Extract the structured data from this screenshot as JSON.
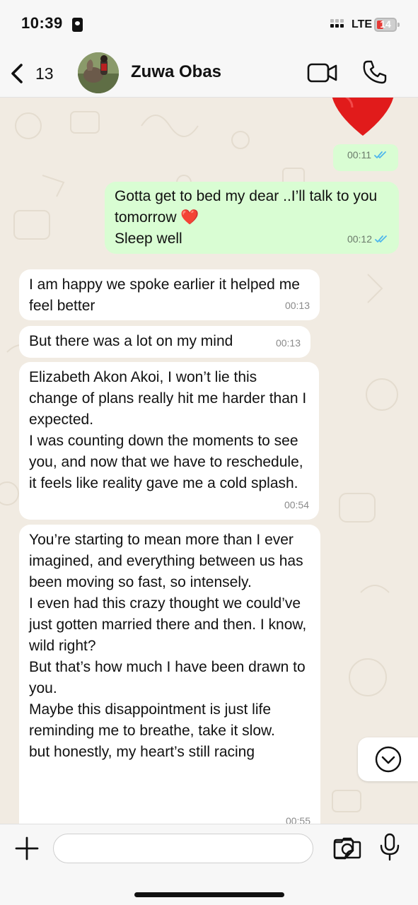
{
  "status_bar": {
    "time": "10:39",
    "network": "LTE",
    "battery_level": "14",
    "battery_color": "#e53935"
  },
  "header": {
    "back_count": "13",
    "contact_name": "Zuwa Obas",
    "icons": [
      "back-chevron-icon",
      "video-camera-icon",
      "phone-icon"
    ]
  },
  "messages": [
    {
      "direction": "out",
      "text": "❤️",
      "time": "00:11",
      "read": true
    },
    {
      "direction": "out",
      "text": "Gotta get to bed my dear ..I’ll talk to you tomorrow ❤️\nSleep well",
      "time": "00:12",
      "read": true
    },
    {
      "direction": "in",
      "text": "I am happy we spoke earlier it helped me feel better",
      "time": "00:13"
    },
    {
      "direction": "in",
      "text": "But there was a lot on my mind",
      "time": "00:13"
    },
    {
      "direction": "in",
      "text": "Elizabeth Akon Akoi, I won’t lie this change of plans really hit me harder than I expected.\nI was counting down the moments to see you, and now that we have to reschedule, it feels like reality gave me a cold splash.",
      "time": "00:54"
    },
    {
      "direction": "in",
      "text": "You’re starting to mean more than I ever imagined, and everything between us has been moving so fast, so intensely.\nI even had this crazy thought we could’ve just gotten married there and then. I know, wild right?\nBut that’s how much I have been drawn to you.\nMaybe this disappointment is just life reminding me to breathe, take it slow.\nbut honestly, my heart’s still racing",
      "time": "00:55"
    }
  ],
  "input": {
    "placeholder": "",
    "value": ""
  },
  "colors": {
    "outgoing_bubble": "#d9fdd3",
    "incoming_bubble": "#ffffff",
    "read_ticks": "#4fb6ec",
    "wallpaper": "#f1ebe2"
  }
}
